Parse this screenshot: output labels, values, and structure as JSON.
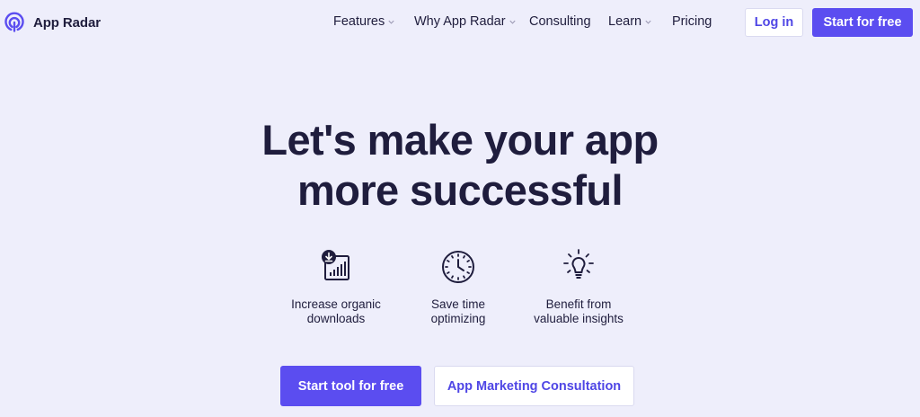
{
  "brand": {
    "name": "App Radar",
    "accent": "#5b4df0",
    "text": "#1f1d3d",
    "background": "#eeeefb"
  },
  "nav": {
    "items": [
      {
        "label": "Features",
        "has_dropdown": true
      },
      {
        "label": "Why App Radar",
        "has_dropdown": true
      },
      {
        "label": "Consulting",
        "has_dropdown": false
      },
      {
        "label": "Learn",
        "has_dropdown": true
      },
      {
        "label": "Pricing",
        "has_dropdown": false
      }
    ],
    "login_label": "Log in",
    "start_label": "Start for free"
  },
  "hero": {
    "title_line1": "Let's make your app",
    "title_line2": "more successful",
    "features": [
      {
        "icon": "download-chart-icon",
        "line1": "Increase organic",
        "line2": "downloads"
      },
      {
        "icon": "clock-icon",
        "line1": "Save time",
        "line2": "optimizing"
      },
      {
        "icon": "lightbulb-icon",
        "line1": "Benefit from",
        "line2": "valuable insights"
      }
    ],
    "cta_primary": "Start tool for free",
    "cta_secondary": "App Marketing Consultation"
  }
}
